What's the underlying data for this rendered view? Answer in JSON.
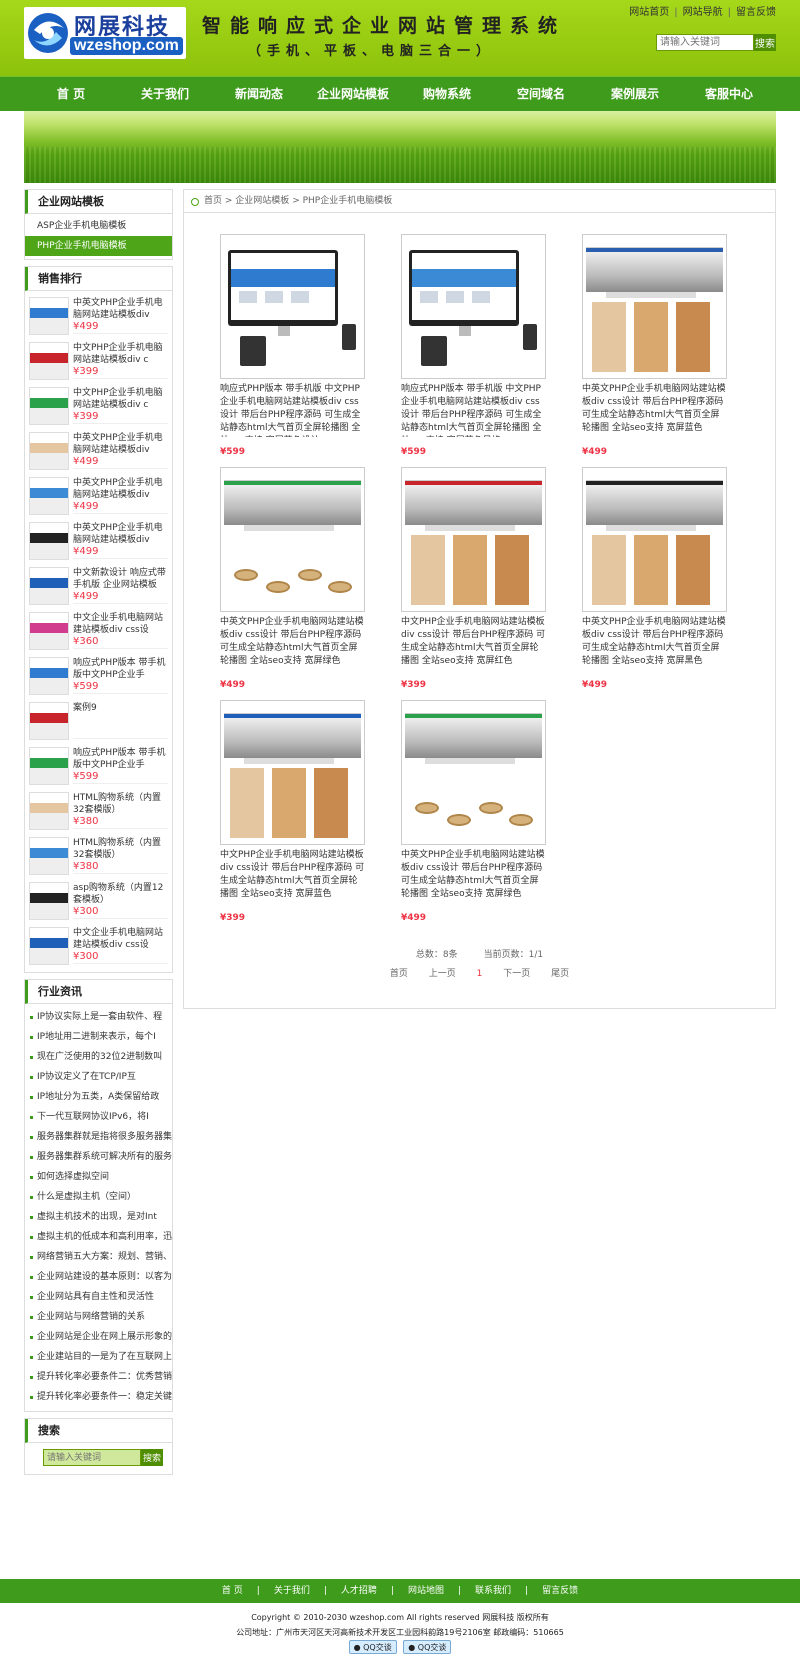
{
  "header": {
    "logo_cn": "网展科技",
    "logo_en": "wzeshop.com",
    "slogan": "智能响应式企业网站管理系统",
    "slogan_sub": "（手机、平板、电脑三合一）",
    "top_links": [
      "网站首页",
      "网站导航",
      "留言反馈"
    ],
    "search_placeholder": "请输入关键词",
    "search_button": "搜索"
  },
  "nav": [
    "首 页",
    "关于我们",
    "新闻动态",
    "企业网站模板",
    "购物系统",
    "空间域名",
    "案例展示",
    "客服中心"
  ],
  "category_box": {
    "title": "企业网站模板",
    "items": [
      "ASP企业手机电脑模板",
      "PHP企业手机电脑模板"
    ]
  },
  "sales": {
    "title": "销售排行",
    "items": [
      {
        "name": "中英文PHP企业手机电脑网站建站模板div",
        "price": "¥499"
      },
      {
        "name": "中文PHP企业手机电脑网站建站模板div c",
        "price": "¥399"
      },
      {
        "name": "中文PHP企业手机电脑网站建站模板div c",
        "price": "¥399"
      },
      {
        "name": "中英文PHP企业手机电脑网站建站模板div",
        "price": "¥499"
      },
      {
        "name": "中英文PHP企业手机电脑网站建站模板div",
        "price": "¥499"
      },
      {
        "name": "中英文PHP企业手机电脑网站建站模板div",
        "price": "¥499"
      },
      {
        "name": "中文新款设计 响应式带手机版 企业网站模板",
        "price": "¥499"
      },
      {
        "name": "中文企业手机电脑网站建站模板div css设",
        "price": "¥360"
      },
      {
        "name": "响应式PHP版本 带手机版中文PHP企业手",
        "price": "¥599"
      },
      {
        "name": "案例9",
        "price": ""
      },
      {
        "name": "响应式PHP版本 带手机版中文PHP企业手",
        "price": "¥599"
      },
      {
        "name": "HTML购物系统（内置32套模版）",
        "price": "¥380"
      },
      {
        "name": "HTML购物系统（内置32套模版）",
        "price": "¥380"
      },
      {
        "name": "asp购物系统（内置12套模板）",
        "price": "¥300"
      },
      {
        "name": "中文企业手机电脑网站建站模板div css设",
        "price": "¥300"
      }
    ]
  },
  "news": {
    "title": "行业资讯",
    "items": [
      "IP协议实际上是一套由软件、程",
      "IP地址用二进制来表示，每个I",
      "现在广泛使用的32位2进制数叫",
      "IP协议定义了在TCP/IP互",
      "IP地址分为五类，A类保留给政",
      "下一代互联网协议IPv6，将I",
      "服务器集群就是指将很多服务器集",
      "服务器集群系统可解决所有的服务",
      "如何选择虚拟空间",
      "什么是虚拟主机（空间）",
      "虚拟主机技术的出现，是对Int",
      "虚拟主机的低成本和高利用率，迅",
      "网络营销五大方案：规划、营销、",
      "企业网站建设的基本原则：以客为",
      "企业网站具有自主性和灵活性",
      "企业网站与网络营销的关系",
      "企业网站是企业在网上展示形象的",
      "企业建站目的一是为了在互联网上",
      "提升转化率必要条件二：优秀营销",
      "提升转化率必要条件一：稳定关键"
    ]
  },
  "side_search": {
    "title": "搜索",
    "placeholder": "请输入关键词",
    "button": "搜索"
  },
  "breadcrumb": [
    "首页",
    "企业网站模板",
    "PHP企业手机电脑模板"
  ],
  "products": [
    {
      "title": "响应式PHP版本 带手机版 中文PHP企业手机电脑网站建站模板div css设计 带后台PHP程序源码 可生成全站静态html大气首页全屏轮播图 全站seo支持 宽屏蓝色设计",
      "price": "¥599",
      "style": "monitor",
      "accent": "#2e7bd0"
    },
    {
      "title": "响应式PHP版本 带手机版 中文PHP企业手机电脑网站建站模板div css设计 带后台PHP程序源码 可生成全站静态html大气首页全屏轮播图 全站seo支持 宽屏蓝色风格",
      "price": "¥599",
      "style": "monitor",
      "accent": "#3a8ad6"
    },
    {
      "title": "中英文PHP企业手机电脑网站建站模板div css设计 带后台PHP程序源码 可生成全站静态html大气首页全屏轮播图 全站seo支持 宽屏蓝色",
      "price": "¥499",
      "style": "full",
      "accent": "#2a5fb0"
    },
    {
      "title": "中英文PHP企业手机电脑网站建站模板div css设计 带后台PHP程序源码 可生成全站静态html大气首页全屏轮播图 全站seo支持 宽屏绿色",
      "price": "¥499",
      "style": "lamp",
      "accent": "#2aa14a"
    },
    {
      "title": "中文PHP企业手机电脑网站建站模板div css设计 带后台PHP程序源码 可生成全站静态html大气首页全屏轮播图 全站seo支持 宽屏红色",
      "price": "¥399",
      "style": "full",
      "accent": "#c8242b"
    },
    {
      "title": "中英文PHP企业手机电脑网站建站模板div css设计 带后台PHP程序源码 可生成全站静态html大气首页全屏轮播图 全站seo支持 宽屏黑色",
      "price": "¥499",
      "style": "full",
      "accent": "#222222"
    },
    {
      "title": "中文PHP企业手机电脑网站建站模板div css设计 带后台PHP程序源码 可生成全站静态html大气首页全屏轮播图 全站seo支持 宽屏蓝色",
      "price": "¥399",
      "style": "full",
      "accent": "#1f5fb8"
    },
    {
      "title": "中英文PHP企业手机电脑网站建站模板div css设计 带后台PHP程序源码 可生成全站静态html大气首页全屏轮播图 全站seo支持 宽屏绿色",
      "price": "¥499",
      "style": "lamp",
      "accent": "#2aa14a"
    }
  ],
  "pager": {
    "total": "总数：8条",
    "pages": "当前页数：1/1",
    "links": [
      "首页",
      "上一页",
      "1",
      "下一页",
      "尾页"
    ]
  },
  "footer": {
    "links": [
      "首 页",
      "关于我们",
      "人才招聘",
      "网站地图",
      "联系我们",
      "留言反馈"
    ],
    "copyright": "Copyright © 2010-2030 wzeshop.com All rights reserved 网展科技 版权所有",
    "address": "公司地址：广州市天河区天河高新技术开发区工业园科韵路19号2106室 邮政编码：510665",
    "qq": [
      "QQ交谈",
      "QQ交谈"
    ]
  },
  "colors": {
    "nav_green": "#3e9b1c",
    "header_green": "#8cc20b",
    "price_red": "#e34"
  }
}
